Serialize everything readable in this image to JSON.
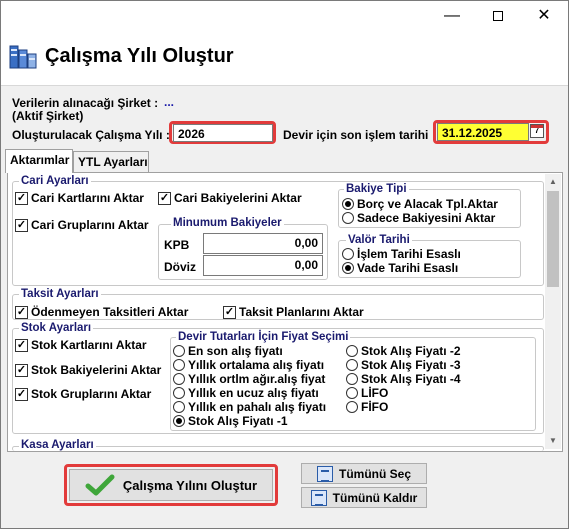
{
  "window": {
    "min_glyph": "—",
    "close_glyph": "✕"
  },
  "header": {
    "title": "Çalışma Yılı Oluştur",
    "icon": "database-icon"
  },
  "source": {
    "label_line1": "Verilerin alınacağı Şirket :",
    "label_line2": "(Aktif Şirket)",
    "value": "..."
  },
  "year": {
    "label": "Oluşturulacak Çalışma Yılı :",
    "value": "2026"
  },
  "devir": {
    "label": "Devir için son işlem tarihi",
    "value": "31.12.2025",
    "cal_day": "7"
  },
  "tabs": [
    {
      "label": "Aktarımlar"
    },
    {
      "label": "YTL Ayarları"
    }
  ],
  "cari": {
    "title": "Cari Ayarları",
    "transfer_cards": "Cari Kartlarını Aktar",
    "transfer_balances": "Cari Bakiyelerini Aktar",
    "transfer_groups": "Cari Gruplarını Aktar",
    "min_title": "Minumum Bakiyeler",
    "kpb_label": "KPB",
    "kpb_value": "0,00",
    "doviz_label": "Döviz",
    "doviz_value": "0,00",
    "bakiye_title": "Bakiye Tipi",
    "bakiye_opt1": "Borç ve Alacak Tpl.Aktar",
    "bakiye_opt2": "Sadece Bakiyesini Aktar",
    "valor_title": "Valör Tarihi",
    "valor_opt1": "İşlem Tarihi Esaslı",
    "valor_opt2": "Vade Tarihi Esaslı"
  },
  "taksit": {
    "title": "Taksit Ayarları",
    "opt1": "Ödenmeyen Taksitleri Aktar",
    "opt2": "Taksit Planlarını Aktar"
  },
  "stok": {
    "title": "Stok Ayarları",
    "cards": "Stok Kartlarını Aktar",
    "balances": "Stok Bakiyelerini Aktar",
    "groups": "Stok Gruplarını Aktar",
    "price_title": "Devir Tutarları İçin Fiyat Seçimi",
    "price_left": [
      "En son alış fiyatı",
      "Yıllık ortalama alış fiyatı",
      "Yıllık ortlm ağır.alış fiyat",
      "Yıllık en ucuz alış fiyatı",
      "Yıllık en pahalı alış fiyatı",
      "Stok Alış Fiyatı -1"
    ],
    "price_right": [
      "Stok Alış Fiyatı -2",
      "Stok Alış Fiyatı -3",
      "Stok Alış Fiyatı -4",
      "LİFO",
      "FİFO"
    ],
    "selected": "Stok Alış Fiyatı -1"
  },
  "kasa": {
    "title": "Kasa Ayarları"
  },
  "buttons": {
    "create": "Çalışma Yılını Oluştur",
    "select_all": "Tümünü Seç",
    "remove_all": "Tümünü Kaldır"
  },
  "colors": {
    "highlight": "#e23b3b",
    "date_bg": "#ffff33",
    "group_title": "#1a1a6e"
  }
}
